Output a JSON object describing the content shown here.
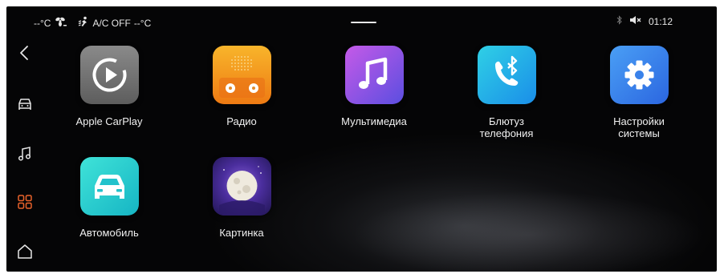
{
  "status_bar": {
    "temp_left": "--°C",
    "fan_icon": "fan-icon",
    "airflow_icon": "airflow-icon",
    "ac_status": "A/C OFF",
    "temp_right": "--°C",
    "bluetooth_icon": "bluetooth-icon",
    "mute_icon": "volume-mute-icon",
    "time": "01:12"
  },
  "sidebar": {
    "items": [
      {
        "name": "back",
        "icon": "chevron-left-icon",
        "active": false
      },
      {
        "name": "car",
        "icon": "car-icon",
        "active": false
      },
      {
        "name": "music",
        "icon": "music-note-icon",
        "active": false
      },
      {
        "name": "apps",
        "icon": "apps-grid-icon",
        "active": true
      },
      {
        "name": "home",
        "icon": "home-icon",
        "active": false
      }
    ],
    "active_color": "#e8622a"
  },
  "apps": [
    {
      "label": "Apple CarPlay",
      "icon": "carplay-icon"
    },
    {
      "label": "Радио",
      "icon": "radio-icon"
    },
    {
      "label": "Мультимедиа",
      "icon": "music-note-icon"
    },
    {
      "label": "Блютуз телефония",
      "icon": "bluetooth-phone-icon"
    },
    {
      "label": "Настройки системы",
      "icon": "gear-icon"
    },
    {
      "label": "Автомобиль",
      "icon": "car-icon"
    },
    {
      "label": "Картинка",
      "icon": "moon-picture-icon"
    }
  ]
}
